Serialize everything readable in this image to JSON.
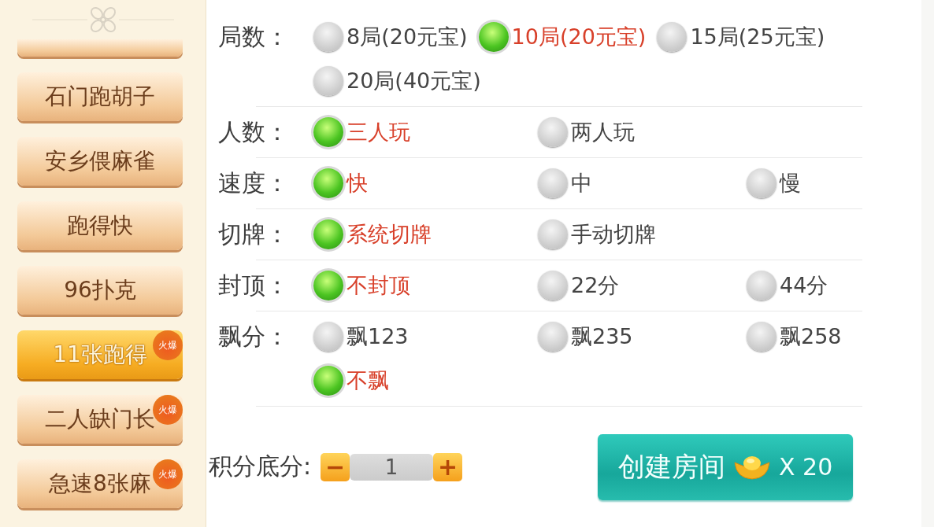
{
  "sidebar": {
    "items": [
      {
        "selected": false
      },
      {
        "label": "石门跑胡子",
        "selected": false
      },
      {
        "label": "安乡偎麻雀",
        "selected": false
      },
      {
        "label": "跑得快",
        "selected": false
      },
      {
        "label": "96扑克",
        "selected": false
      },
      {
        "label": "11张跑得",
        "selected": true,
        "badge": "火爆"
      },
      {
        "label": "二人缺门长",
        "selected": false,
        "badge": "火爆"
      },
      {
        "label": "急速8张麻",
        "selected": false,
        "badge": "火爆"
      }
    ]
  },
  "settings": [
    {
      "label": "局数：",
      "kind": "inline",
      "options": [
        {
          "label": "8局(20元宝)",
          "selected": false
        },
        {
          "label": "10局(20元宝)",
          "selected": true
        },
        {
          "label": "15局(25元宝)",
          "selected": false
        },
        {
          "label": "20局(40元宝)",
          "selected": false
        }
      ]
    },
    {
      "label": "人数：",
      "kind": "columns",
      "options": [
        {
          "label": "三人玩",
          "selected": true
        },
        {
          "label": "两人玩",
          "selected": false
        }
      ]
    },
    {
      "label": "速度：",
      "kind": "columns",
      "options": [
        {
          "label": "快",
          "selected": true
        },
        {
          "label": "中",
          "selected": false
        },
        {
          "label": "慢",
          "selected": false
        }
      ]
    },
    {
      "label": "切牌：",
      "kind": "columns",
      "options": [
        {
          "label": "系统切牌",
          "selected": true
        },
        {
          "label": "手动切牌",
          "selected": false
        }
      ]
    },
    {
      "label": "封顶：",
      "kind": "columns",
      "options": [
        {
          "label": "不封顶",
          "selected": true
        },
        {
          "label": "22分",
          "selected": false
        },
        {
          "label": "44分",
          "selected": false
        }
      ]
    },
    {
      "label": "飘分：",
      "kind": "columns",
      "options": [
        {
          "label": "飘123",
          "selected": false
        },
        {
          "label": "飘235",
          "selected": false
        },
        {
          "label": "飘258",
          "selected": false
        },
        {
          "label": "不飘",
          "selected": true
        }
      ]
    }
  ],
  "base_score": {
    "label": "积分底分:",
    "minus": "−",
    "value": "1",
    "plus": "+"
  },
  "create_button": {
    "label": "创建房间",
    "cost": "X 20"
  }
}
